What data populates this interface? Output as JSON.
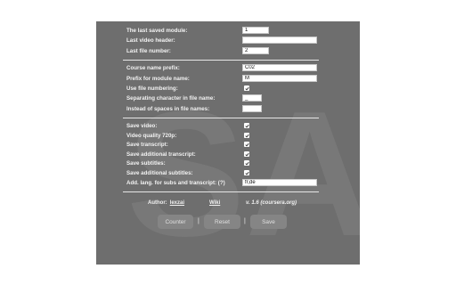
{
  "settings": {
    "last_saved_module": {
      "label": "The last saved module:",
      "value": "1"
    },
    "last_video_header": {
      "label": "Last video header:",
      "value": ""
    },
    "last_file_number": {
      "label": "Last file number:",
      "value": "2"
    },
    "course_name_prefix": {
      "label": "Course name prefix:",
      "value": "C02"
    },
    "prefix_module_name": {
      "label": "Prefix for module name:",
      "value": "M"
    },
    "use_file_numbering": {
      "label": "Use file numbering:",
      "checked": true
    },
    "separating_character": {
      "label": "Separating character in file name:",
      "value": "_"
    },
    "instead_of_spaces": {
      "label": "Instead of spaces in file names:",
      "value": ""
    },
    "save_video": {
      "label": "Save video:",
      "checked": true
    },
    "video_quality": {
      "label": "Video quality 720p:",
      "checked": true
    },
    "save_transcript": {
      "label": "Save transcript:",
      "checked": true
    },
    "save_additional_transcript": {
      "label": "Save additional transcript:",
      "checked": true
    },
    "save_subtitles": {
      "label": "Save subtitles:",
      "checked": true
    },
    "save_additional_subtitles": {
      "label": "Save additional subtitles:",
      "checked": true
    },
    "add_lang": {
      "label": "Add. lang. for subs and transcript: (?)",
      "value": "fr,de"
    }
  },
  "footer": {
    "author_label": "Author:",
    "author_link": "lexzai",
    "wiki_link": "Wiki",
    "version": "v. 1.6 (coursera.org)"
  },
  "buttons": {
    "counter": "Counter",
    "reset": "Reset",
    "save": "Save",
    "separator": "|"
  },
  "watermark_text": "SA",
  "colors": {
    "panel": "#6e6e6e",
    "button": "#858585",
    "label": "#f2f2f2"
  }
}
